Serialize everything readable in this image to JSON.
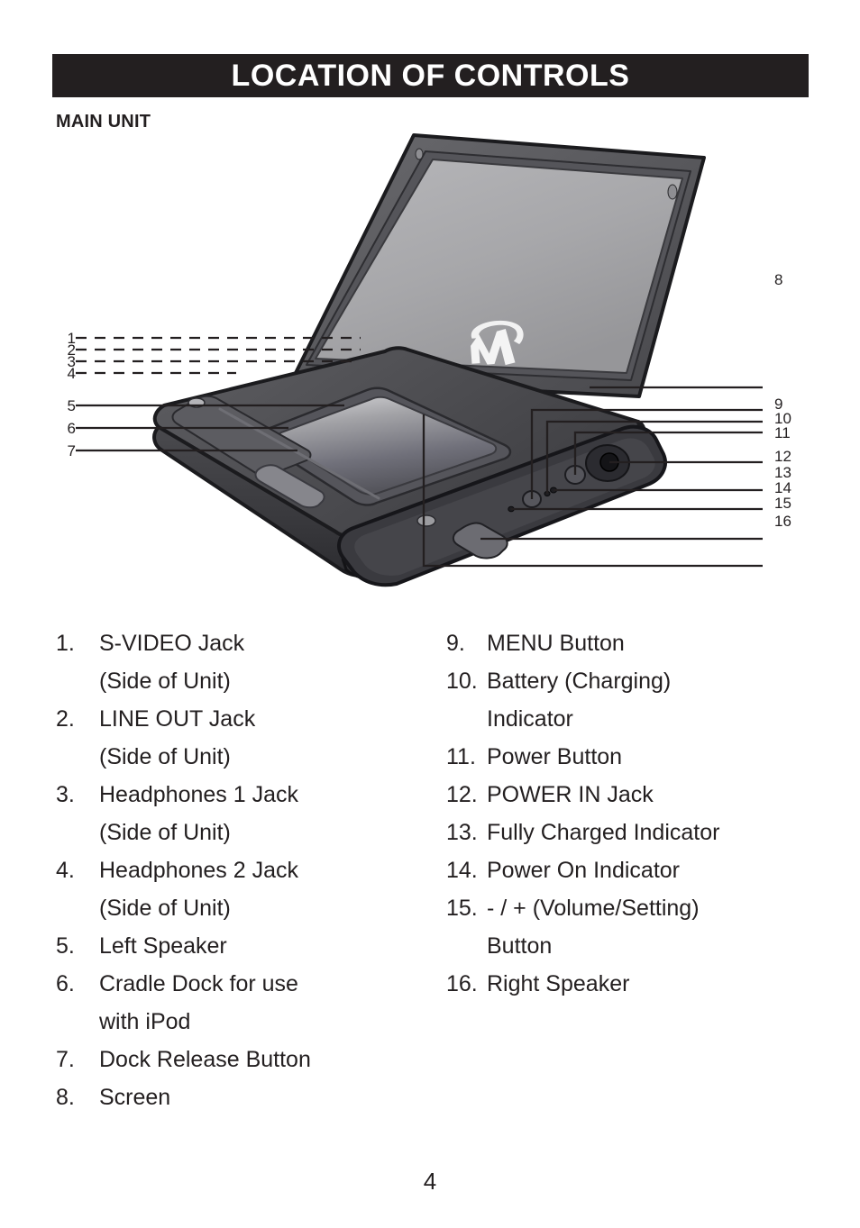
{
  "header": {
    "title": "LOCATION OF CONTROLS",
    "section_label": "MAIN UNIT",
    "bar_color": "#231f20",
    "title_color": "#ffffff"
  },
  "figure": {
    "caption": "",
    "screen_logo": "memorex-m-logo",
    "body_color": "#4a4a4d",
    "screen_color": "#a9a9ac",
    "callouts_left": [
      {
        "number": "1",
        "style": "dashed"
      },
      {
        "number": "2",
        "style": "dashed"
      },
      {
        "number": "3",
        "style": "dashed"
      },
      {
        "number": "4",
        "style": "dashed"
      },
      {
        "number": "5",
        "style": "solid"
      },
      {
        "number": "6",
        "style": "solid"
      },
      {
        "number": "7",
        "style": "solid"
      }
    ],
    "callouts_right": [
      {
        "number": "8",
        "style": "solid"
      },
      {
        "number": "9",
        "style": "solid"
      },
      {
        "number": "10",
        "style": "solid"
      },
      {
        "number": "11",
        "style": "solid"
      },
      {
        "number": "12",
        "style": "solid"
      },
      {
        "number": "13",
        "style": "solid"
      },
      {
        "number": "14",
        "style": "solid"
      },
      {
        "number": "15",
        "style": "solid"
      },
      {
        "number": "16",
        "style": "solid"
      }
    ]
  },
  "list_left": [
    {
      "num": "1.",
      "text": "S-VIDEO Jack",
      "cont": "(Side of Unit)"
    },
    {
      "num": "2.",
      "text": "LINE OUT Jack",
      "cont": "(Side of Unit)"
    },
    {
      "num": "3.",
      "text": "Headphones 1 Jack",
      "cont": "(Side of Unit)"
    },
    {
      "num": "4.",
      "text": "Headphones 2 Jack",
      "cont": "(Side of Unit)"
    },
    {
      "num": "5.",
      "text": "Left Speaker",
      "cont": ""
    },
    {
      "num": "6.",
      "text": "Cradle Dock for use",
      "cont": "with iPod"
    },
    {
      "num": "7.",
      "text": "Dock Release Button",
      "cont": ""
    },
    {
      "num": "8.",
      "text": "Screen",
      "cont": ""
    }
  ],
  "list_right": [
    {
      "num": "9.",
      "text": "MENU Button",
      "cont": ""
    },
    {
      "num": "10.",
      "text": "Battery (Charging)",
      "cont": "Indicator"
    },
    {
      "num": "11.",
      "text": "Power Button",
      "cont": ""
    },
    {
      "num": "12.",
      "text": "POWER IN Jack",
      "cont": ""
    },
    {
      "num": "13.",
      "text": "Fully Charged Indicator",
      "cont": ""
    },
    {
      "num": "14.",
      "text": "Power On Indicator",
      "cont": ""
    },
    {
      "num": "15.",
      "text": "- / + (Volume/Setting)",
      "cont": "Button"
    },
    {
      "num": "16.",
      "text": "Right Speaker",
      "cont": ""
    }
  ],
  "footer": {
    "page_number": "4"
  }
}
